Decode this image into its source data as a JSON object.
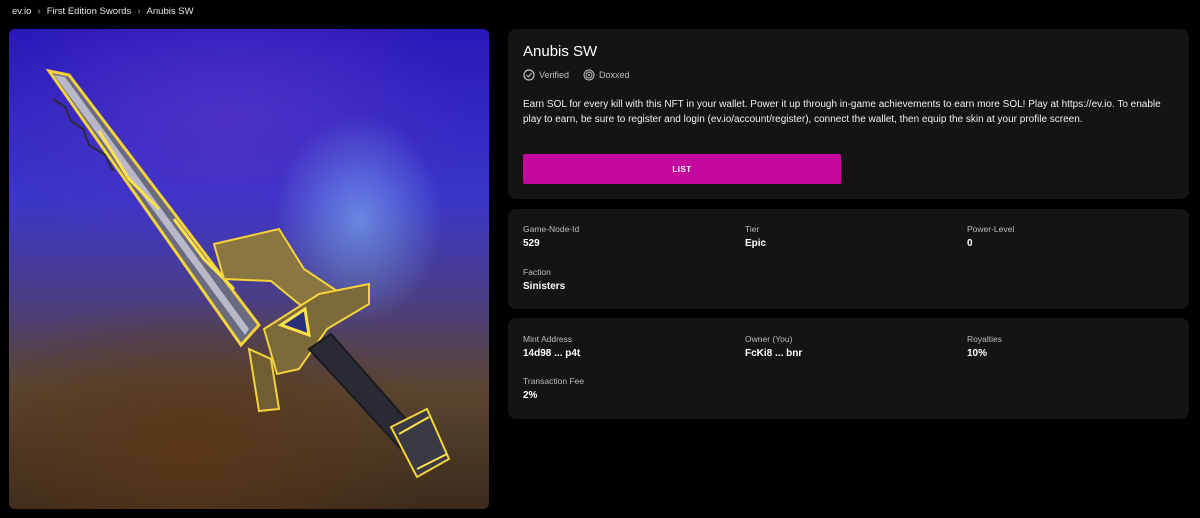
{
  "breadcrumb": {
    "items": [
      "ev.io",
      "First Edition Swords",
      "Anubis SW"
    ]
  },
  "nft": {
    "title": "Anubis SW",
    "badges": {
      "verified": "Verified",
      "doxxed": "Doxxed"
    },
    "description": "Earn SOL for every kill with this NFT in your wallet. Power it up through in-game achievements to earn more SOL! Play at https://ev.io. To enable play to earn, be sure to register and login (ev.io/account/register), connect the wallet, then equip the skin at your profile screen.",
    "list_label": "LIST",
    "list_color": "#c3089b"
  },
  "attributes": [
    {
      "label": "Game-Node-Id",
      "value": "529"
    },
    {
      "label": "Tier",
      "value": "Epic"
    },
    {
      "label": "Power-Level",
      "value": "0"
    },
    {
      "label": "Faction",
      "value": "Sinisters"
    }
  ],
  "details": [
    {
      "label": "Mint Address",
      "value": "14d98 ... p4t"
    },
    {
      "label": "Owner (You)",
      "value": "FcKi8 ... bnr"
    },
    {
      "label": "Royalties",
      "value": "10%"
    },
    {
      "label": "Transaction Fee",
      "value": "2%"
    }
  ],
  "icons": {
    "verified": "verified-check-icon",
    "doxxed": "fingerprint-icon",
    "separator": "chevron-right-icon"
  }
}
